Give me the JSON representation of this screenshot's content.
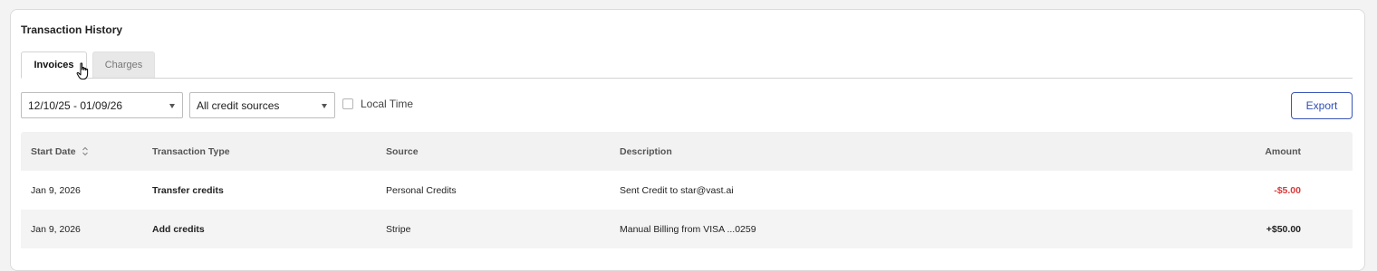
{
  "panel": {
    "title": "Transaction History"
  },
  "tabs": [
    {
      "label": "Invoices",
      "active": true
    },
    {
      "label": "Charges",
      "active": false
    }
  ],
  "filters": {
    "date_range": "12/10/25 - 01/09/26",
    "credit_source": "All credit sources",
    "local_time_label": "Local Time",
    "local_time_checked": false
  },
  "actions": {
    "export_label": "Export"
  },
  "table": {
    "columns": {
      "start_date": "Start Date",
      "transaction_type": "Transaction Type",
      "source": "Source",
      "description": "Description",
      "amount": "Amount"
    },
    "rows": [
      {
        "start_date": "Jan 9, 2026",
        "transaction_type": "Transfer credits",
        "source": "Personal Credits",
        "description": "Sent Credit to star@vast.ai",
        "amount": "-$5.00"
      },
      {
        "start_date": "Jan 9, 2026",
        "transaction_type": "Add credits",
        "source": "Stripe",
        "description": "Manual Billing from VISA ...0259",
        "amount": "+$50.00"
      }
    ]
  },
  "colors": {
    "accent": "#2f4fb5",
    "negative": "#d93a3a"
  },
  "icons": {
    "sort": "sort-icon",
    "dropdown": "chevron-down-icon",
    "cursor": "hand-pointer-icon"
  }
}
